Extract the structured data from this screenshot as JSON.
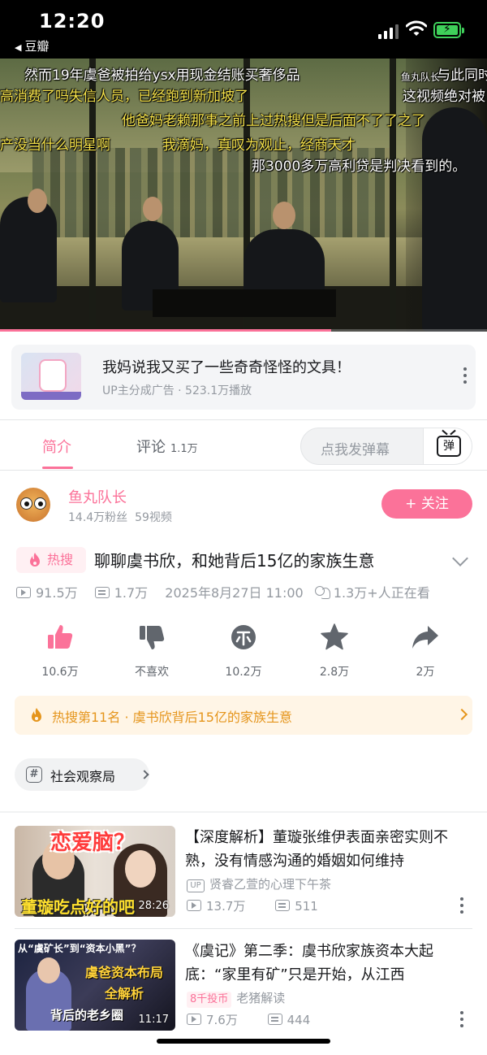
{
  "status_bar": {
    "time": "12:20",
    "back_app": "豆瓣"
  },
  "player": {
    "danmaku": [
      "然而19年虞爸被拍给ysx用现金结账买奢侈品",
      "高消费了吗失信人员，已经跑到新加坡了",
      "他爸妈老赖那事之前上过热搜但是后面不了了之了",
      "产没当什么明星啊",
      "我滴妈，真叹为观止，经商天才",
      "那3000多万高利贷是判决看到的。",
      "鱼丸队长",
      "与此同时",
      "这视频绝对被"
    ],
    "progress": 0.68
  },
  "ad": {
    "title": "我妈说我又买了一些奇奇怪怪的文具！",
    "subtitle": "UP主分成广告 · 523.1万播放"
  },
  "tabs": {
    "intro": "简介",
    "comments": "评论",
    "comments_count": "1.1万",
    "danmaku_placeholder": "点我发弹幕",
    "danmaku_button": "弹"
  },
  "uploader": {
    "name": "鱼丸队长",
    "fans": "14.4万粉丝",
    "videos": "59视频",
    "follow_label": "+ 关注"
  },
  "video": {
    "hot_tag": "热搜",
    "title": "聊聊虞书欣，和她背后15亿的家族生意",
    "views": "91.5万",
    "danmaku_count": "1.7万",
    "date": "2025年8月27日 11:00",
    "watching": "1.3万+人正在看"
  },
  "actions": [
    {
      "icon": "thumbs-up-icon",
      "label": "10.6万"
    },
    {
      "icon": "thumbs-down-icon",
      "label": "不喜欢"
    },
    {
      "icon": "coin-icon",
      "label": "10.2万"
    },
    {
      "icon": "star-icon",
      "label": "2.8万"
    },
    {
      "icon": "share-icon",
      "label": "2万"
    }
  ],
  "hot_banner": {
    "text": "热搜第11名 · 虞书欣背后15亿的家族生意"
  },
  "channel": {
    "name": "社会观察局"
  },
  "recommendations": [
    {
      "thumb_text_top": "恋爱脑？",
      "thumb_text_bottom": "董璇吃点好的吧",
      "duration": "28:26",
      "title": "【深度解析】董璇张维伊表面亲密实则不熟，没有情感沟通的婚姻如何维持",
      "up_badge": "UP",
      "up_name": "贤睿乙萱的心理下午茶",
      "views": "13.7万",
      "danmaku": "511"
    },
    {
      "thumb_text_top": "从“虞矿长”到“资本小黑”？",
      "thumb_text_mid": "虞爸资本布局全解析",
      "thumb_text_bottom": "背后的老乡圈",
      "duration": "11:17",
      "title": "《虞记》第二季：虞书欣家族资本大起底：“家里有矿”只是开始，从江西",
      "coin_badge": "8千投币",
      "up_name": "老猪解读",
      "views": "7.6万",
      "danmaku": "444"
    }
  ],
  "colors": {
    "accent": "#fb7299",
    "hot": "#e5951c",
    "muted": "#9499a0"
  }
}
